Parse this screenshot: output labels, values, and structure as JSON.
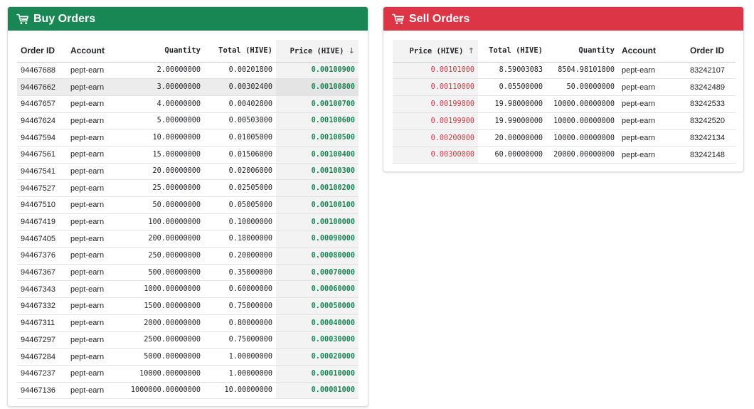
{
  "buy": {
    "title": "Buy Orders",
    "icon": "cart-icon",
    "header_color": "#198754",
    "columns": [
      "Order ID",
      "Account",
      "Quantity",
      "Total (HIVE)",
      "Price (HIVE)"
    ],
    "sort_arrow": "↓",
    "rows": [
      [
        "94467688",
        "pept-earn",
        "2.00000000",
        "0.00201800",
        "0.00100900"
      ],
      [
        "94467662",
        "pept-earn",
        "3.00000000",
        "0.00302400",
        "0.00100800"
      ],
      [
        "94467657",
        "pept-earn",
        "4.00000000",
        "0.00402800",
        "0.00100700"
      ],
      [
        "94467624",
        "pept-earn",
        "5.00000000",
        "0.00503000",
        "0.00100600"
      ],
      [
        "94467594",
        "pept-earn",
        "10.00000000",
        "0.01005000",
        "0.00100500"
      ],
      [
        "94467561",
        "pept-earn",
        "15.00000000",
        "0.01506000",
        "0.00100400"
      ],
      [
        "94467541",
        "pept-earn",
        "20.00000000",
        "0.02006000",
        "0.00100300"
      ],
      [
        "94467527",
        "pept-earn",
        "25.00000000",
        "0.02505000",
        "0.00100200"
      ],
      [
        "94467510",
        "pept-earn",
        "50.00000000",
        "0.05005000",
        "0.00100100"
      ],
      [
        "94467419",
        "pept-earn",
        "100.00000000",
        "0.10000000",
        "0.00100000"
      ],
      [
        "94467405",
        "pept-earn",
        "200.00000000",
        "0.18000000",
        "0.00090000"
      ],
      [
        "94467376",
        "pept-earn",
        "250.00000000",
        "0.20000000",
        "0.00080000"
      ],
      [
        "94467367",
        "pept-earn",
        "500.00000000",
        "0.35000000",
        "0.00070000"
      ],
      [
        "94467343",
        "pept-earn",
        "1000.00000000",
        "0.60000000",
        "0.00060000"
      ],
      [
        "94467332",
        "pept-earn",
        "1500.00000000",
        "0.75000000",
        "0.00050000"
      ],
      [
        "94467311",
        "pept-earn",
        "2000.00000000",
        "0.80000000",
        "0.00040000"
      ],
      [
        "94467297",
        "pept-earn",
        "2500.00000000",
        "0.75000000",
        "0.00030000"
      ],
      [
        "94467284",
        "pept-earn",
        "5000.00000000",
        "1.00000000",
        "0.00020000"
      ],
      [
        "94467237",
        "pept-earn",
        "10000.00000000",
        "1.00000000",
        "0.00010000"
      ],
      [
        "94467136",
        "pept-earn",
        "1000000.00000000",
        "10.00000000",
        "0.00001000"
      ]
    ]
  },
  "sell": {
    "title": "Sell Orders",
    "icon": "cart-icon",
    "header_color": "#dc3545",
    "columns": [
      "Price (HIVE)",
      "Total (HIVE)",
      "Quantity",
      "Account",
      "Order ID"
    ],
    "sort_arrow": "↑",
    "rows": [
      [
        "0.00101000",
        "8.59003083",
        "8504.98101800",
        "pept-earn",
        "83242107"
      ],
      [
        "0.00110000",
        "0.05500000",
        "50.00000000",
        "pept-earn",
        "83242489"
      ],
      [
        "0.00199800",
        "19.98000000",
        "10000.00000000",
        "pept-earn",
        "83242533"
      ],
      [
        "0.00199900",
        "19.99000000",
        "10000.00000000",
        "pept-earn",
        "83242520"
      ],
      [
        "0.00200000",
        "20.00000000",
        "10000.00000000",
        "pept-earn",
        "83242134"
      ],
      [
        "0.00300000",
        "60.00000000",
        "20000.00000000",
        "pept-earn",
        "83242148"
      ]
    ]
  }
}
